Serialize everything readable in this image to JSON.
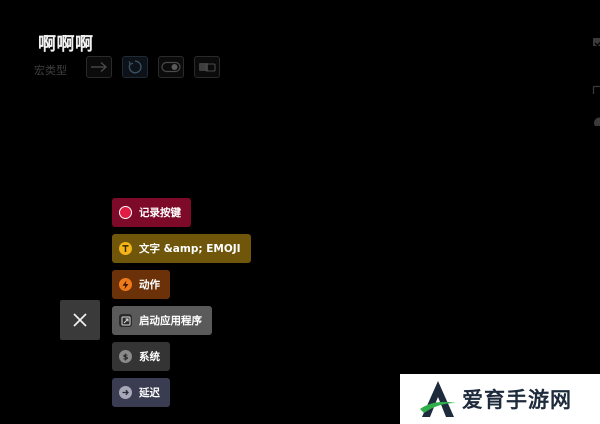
{
  "header": {
    "title": "啊啊啊",
    "type_label": "宏类型",
    "type_options": [
      {
        "icon": "arrow-right-icon",
        "selected": false
      },
      {
        "icon": "refresh-icon",
        "selected": true
      },
      {
        "icon": "toggle-icon",
        "selected": false
      },
      {
        "icon": "keyboard-switch-icon",
        "selected": false
      }
    ]
  },
  "fab": {
    "close_icon": "close-icon"
  },
  "menu": [
    {
      "label": "记录按键",
      "icon": "record-icon",
      "bg": "#7d0a29",
      "icon_color": "#e01c44"
    },
    {
      "label": "文字 &amp; EMOJI",
      "icon": "text-icon",
      "bg": "#6f560b",
      "icon_color": "#f5b417"
    },
    {
      "label": "动作",
      "icon": "lightning-icon",
      "bg": "#6b3209",
      "icon_color": "#f07a1a"
    },
    {
      "label": "启动应用程序",
      "icon": "app-launch-icon",
      "bg": "#5a5a5a",
      "icon_color": "#2a2a2a"
    },
    {
      "label": "系统",
      "icon": "system-icon",
      "bg": "#343434",
      "icon_color": "#8a8a8a"
    },
    {
      "label": "延迟",
      "icon": "delay-icon",
      "bg": "#3a3c52",
      "icon_color": "#a8a9b8"
    }
  ],
  "watermark": {
    "text": "爱育手游网",
    "logo_letter": "A"
  },
  "colors": {
    "background": "#000000",
    "title": "#f0f0f0",
    "muted": "#3f3f3f",
    "watermark_green": "#2fae49",
    "watermark_navy": "#1e2b3c"
  }
}
